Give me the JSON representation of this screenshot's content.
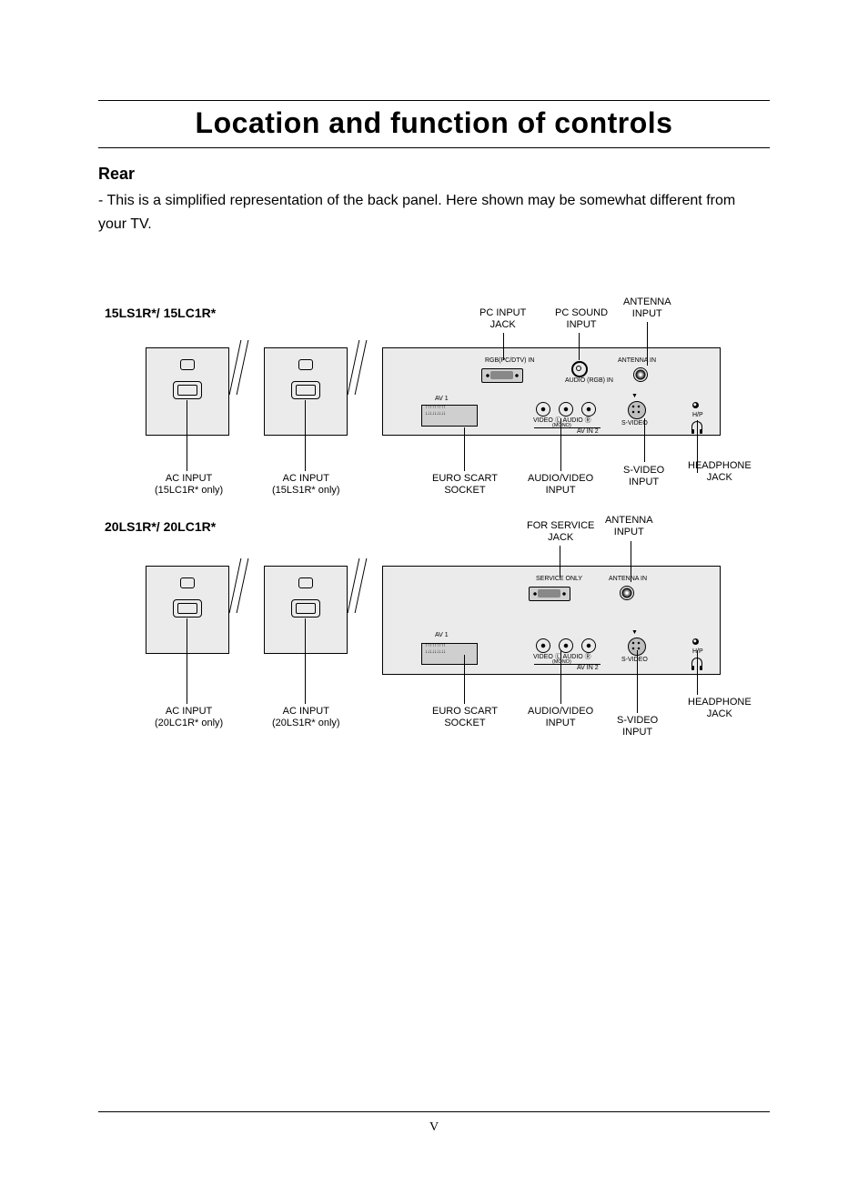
{
  "title": "Location and function of controls",
  "subhead": "Rear",
  "intro": "- This is a simplified representation of the back panel. Here shown may be somewhat different from\n  your TV.",
  "page_number": "V",
  "model1": {
    "label": "15LS1R*/ 15LC1R*"
  },
  "model2": {
    "label": "20LS1R*/ 20LC1R*"
  },
  "callouts": {
    "pc_input": "PC INPUT\nJACK",
    "pc_sound": "PC SOUND\nINPUT",
    "antenna": "ANTENNA\nINPUT",
    "ac_15lc": "AC INPUT\n(15LC1R* only)",
    "ac_15ls": "AC INPUT\n(15LS1R* only)",
    "ac_20lc": "AC INPUT\n(20LC1R* only)",
    "ac_20ls": "AC INPUT\n(20LS1R* only)",
    "euro": "EURO SCART\nSOCKET",
    "av": "AUDIO/VIDEO\nINPUT",
    "svideo": "S-VIDEO\nINPUT",
    "headphone": "HEADPHONE\nJACK",
    "service": "FOR SERVICE\nJACK"
  },
  "panel_text": {
    "rgb_in": "RGB(PC/DTV) IN",
    "audio_rgb": "AUDIO\n(RGB) IN",
    "service_only": "SERVICE ONLY",
    "antenna_in": "ANTENNA IN",
    "av1": "AV 1",
    "video": "VIDEO",
    "audio_lr": "Ⓛ AUDIO Ⓡ",
    "mono": "(MONO)",
    "av_in2": "AV IN 2",
    "svideo": "S-VIDEO",
    "hp": "H/P",
    "arrow_down": "▼"
  }
}
